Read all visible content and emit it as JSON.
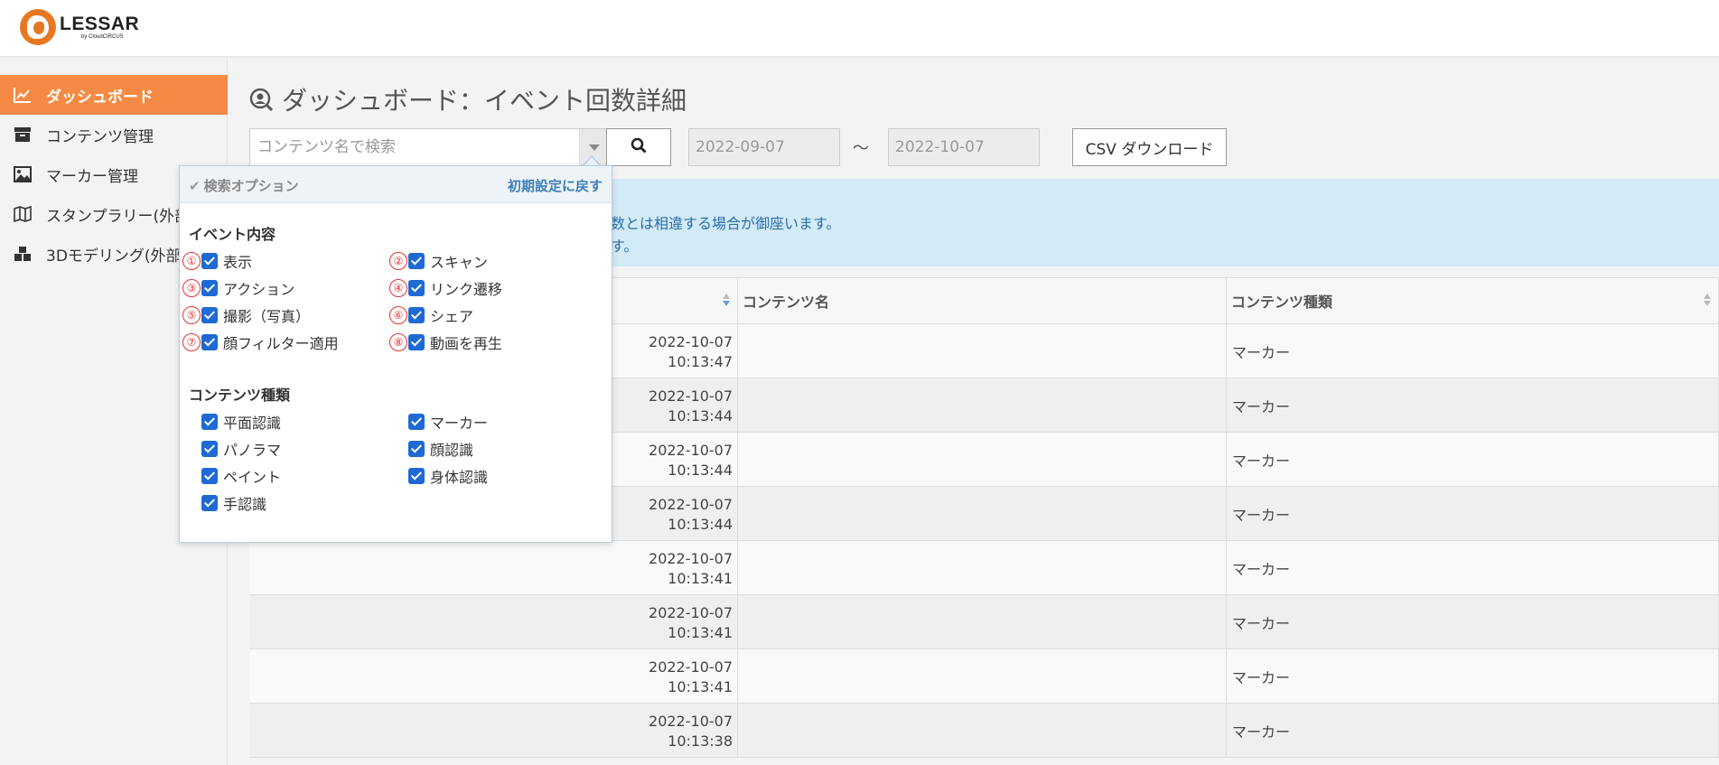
{
  "app": {
    "logo_name": "LESSAR",
    "logo_sub": "by CloudCIRCUS"
  },
  "sidebar": {
    "items": [
      {
        "label": "ダッシュボード",
        "icon": "chart-line-icon",
        "active": true
      },
      {
        "label": "コンテンツ管理",
        "icon": "archive-box-icon",
        "active": false
      },
      {
        "label": "マーカー管理",
        "icon": "image-icon",
        "active": false
      },
      {
        "label": "スタンプラリー(外部",
        "icon": "map-icon",
        "active": false
      },
      {
        "label": "3Dモデリング(外部",
        "icon": "cubes-icon",
        "active": false
      }
    ]
  },
  "page": {
    "title": "ダッシュボード：イベント回数詳細"
  },
  "search": {
    "placeholder": "コンテンツ名で検索",
    "value": ""
  },
  "dates": {
    "from": "2022-09-07",
    "separator": "〜",
    "to": "2022-10-07"
  },
  "csv_button": "CSV ダウンロード",
  "banner": {
    "line1": "数とは相違する場合が御座います。",
    "line2": "す。"
  },
  "table": {
    "headers": [
      "",
      "コンテンツ名",
      "コンテンツ種類"
    ],
    "rows": [
      {
        "date": "2022-10-07",
        "time": "10:13:47",
        "name": "",
        "type": "マーカー"
      },
      {
        "date": "2022-10-07",
        "time": "10:13:44",
        "name": "",
        "type": "マーカー"
      },
      {
        "date": "2022-10-07",
        "time": "10:13:44",
        "name": "",
        "type": "マーカー"
      },
      {
        "date": "2022-10-07",
        "time": "10:13:44",
        "name": "",
        "type": "マーカー"
      },
      {
        "date": "2022-10-07",
        "time": "10:13:41",
        "name": "",
        "type": "マーカー"
      },
      {
        "date": "2022-10-07",
        "time": "10:13:41",
        "name": "",
        "type": "マーカー"
      },
      {
        "date": "2022-10-07",
        "time": "10:13:41",
        "name": "",
        "type": "マーカー"
      },
      {
        "date": "2022-10-07",
        "time": "10:13:38",
        "name": "",
        "type": "マーカー"
      }
    ]
  },
  "popup": {
    "title": "検索オプション",
    "reset": "初期設定に戻す",
    "event_title": "イベント内容",
    "events": [
      {
        "num": "①",
        "label": "表示",
        "checked": true
      },
      {
        "num": "②",
        "label": "スキャン",
        "checked": true
      },
      {
        "num": "③",
        "label": "アクション",
        "checked": true
      },
      {
        "num": "④",
        "label": "リンク遷移",
        "checked": true
      },
      {
        "num": "⑤",
        "label": "撮影（写真）",
        "checked": true
      },
      {
        "num": "⑥",
        "label": "シェア",
        "checked": true
      },
      {
        "num": "⑦",
        "label": "顔フィルター適用",
        "checked": true
      },
      {
        "num": "⑧",
        "label": "動画を再生",
        "checked": true
      }
    ],
    "content_title": "コンテンツ種類",
    "contents": [
      {
        "label": "平面認識",
        "checked": true
      },
      {
        "label": "マーカー",
        "checked": true
      },
      {
        "label": "パノラマ",
        "checked": true
      },
      {
        "label": "顔認識",
        "checked": true
      },
      {
        "label": "ペイント",
        "checked": true
      },
      {
        "label": "身体認識",
        "checked": true
      },
      {
        "label": "手認識",
        "checked": true
      }
    ]
  },
  "colors": {
    "accent": "#f58a44",
    "checkbox": "#1e6ad2",
    "banner": "#d3eaf7",
    "link": "#3c7fb8"
  }
}
